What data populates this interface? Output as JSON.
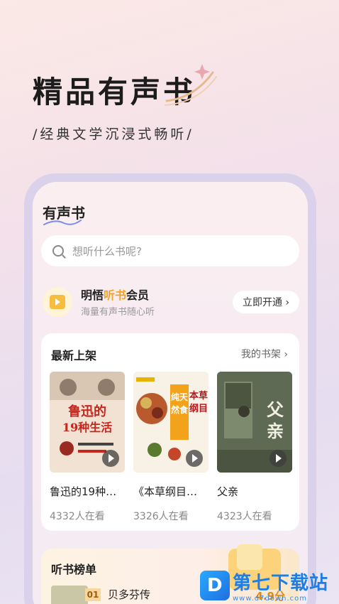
{
  "hero": {
    "title": "精品有声书",
    "subtitle": "/经典文学沉浸式畅听/"
  },
  "app": {
    "title": "有声书",
    "search": {
      "placeholder": "想听什么书呢?"
    },
    "vip": {
      "name_prefix": "明悟",
      "name_highlight": "听书",
      "name_suffix": "会员",
      "description": "海量有声书随心听",
      "button_label": "立即开通 ›"
    },
    "new_shelf": {
      "title": "最新上架",
      "link_label": "我的书架 ›",
      "books": [
        {
          "title": "鲁迅的19种…",
          "count": "4332人在看",
          "cover_text": "鲁迅的19种生活",
          "cover_color": "#f1e2d3"
        },
        {
          "title": "《本草纲目…",
          "count": "3326人在看",
          "cover_text": "本草纲目 纯天然食材",
          "cover_color": "#f7f1e6"
        },
        {
          "title": "父亲",
          "count": "4323人在看",
          "cover_text": "父亲",
          "cover_color": "#5f6a55"
        }
      ]
    },
    "ranking": {
      "title": "听书榜单",
      "items": [
        {
          "rank": "01",
          "name": "贝多芬传",
          "score": "4.9分"
        }
      ]
    }
  },
  "watermark": {
    "brand": "第七下载站",
    "url": "www.d7down.com"
  },
  "colors": {
    "accent": "#f2a125",
    "vip_icon": "#f6bd3f",
    "watermark_blue": "#1e7de6"
  }
}
